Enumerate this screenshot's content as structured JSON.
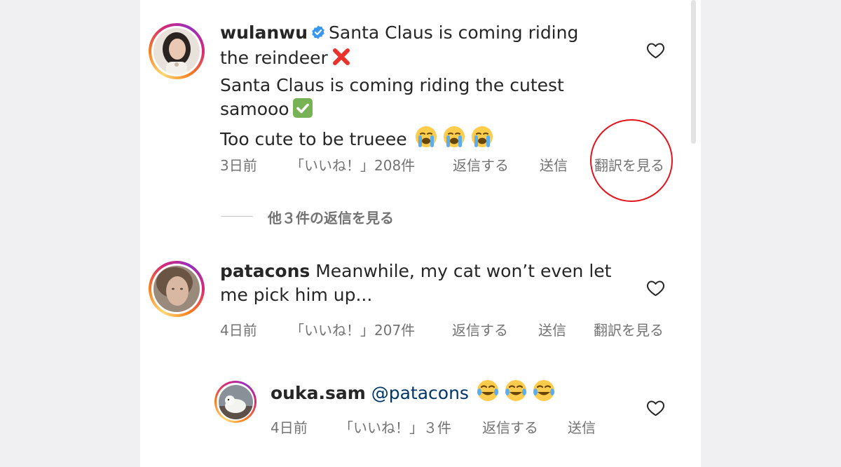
{
  "comments": [
    {
      "username": "wulanwu",
      "verified": true,
      "lines": [
        "Santa Claus is coming riding",
        "the reindeer",
        "Santa Claus is coming riding the cutest",
        "samooo",
        "Too cute to be trueee"
      ],
      "time": "3日前",
      "likes": "「いいね！」208件",
      "reply": "返信する",
      "send": "送信",
      "translate": "翻訳を見る"
    },
    {
      "username": "patacons",
      "verified": false,
      "lines": [
        "Meanwhile, my cat won’t even let",
        "me pick him up..."
      ],
      "time": "4日前",
      "likes": "「いいね！」207件",
      "reply": "返信する",
      "send": "送信",
      "translate": "翻訳を見る"
    }
  ],
  "view_replies": "他３件の返信を見る",
  "reply": {
    "username": "ouka.sam",
    "mention": "@patacons",
    "time": "4日前",
    "likes": "「いいね！」３件",
    "reply": "返信する",
    "send": "送信"
  },
  "icons": {
    "like": "heart-outline-icon",
    "verified": "verified-badge-icon",
    "cross": "cross-mark-emoji",
    "check": "check-mark-emoji",
    "crying": "loudly-crying-emoji",
    "laughing": "tears-of-joy-emoji"
  },
  "colors": {
    "username": "#262626",
    "meta": "#737373",
    "mention": "#00376b",
    "verified": "#3897f0",
    "highlight_circle": "#e3141c"
  }
}
